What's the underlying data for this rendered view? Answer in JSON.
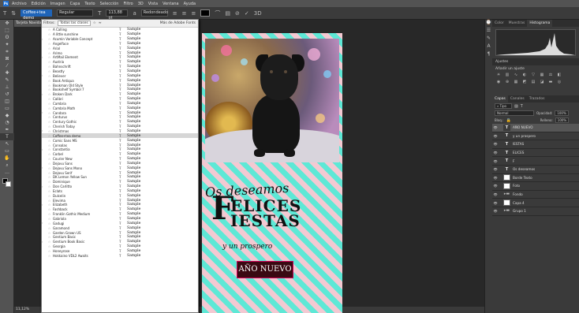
{
  "app": {
    "logo": "Ps"
  },
  "menu": [
    "Archivo",
    "Edición",
    "Imagen",
    "Capa",
    "Texto",
    "Selección",
    "Filtro",
    "3D",
    "Vista",
    "Ventana",
    "Ayuda"
  ],
  "options": {
    "font_family": "Coffee+tea demo",
    "font_style": "Regular",
    "font_size": "113,88 pt",
    "antialias": "Redondeado",
    "text_color": "#000000"
  },
  "document": {
    "tab_title": "Tarjeta Navidad.psd",
    "zoom": "11,12%"
  },
  "font_panel": {
    "filter_label": "Filtros:",
    "filter_value": "Todas las clases",
    "adobe_fonts": "Más de Adobe Fonts",
    "sample": "Sample",
    "fonts": [
      "A Calling",
      "A little sunshine",
      "Acumin Variable Concept",
      "Angelface",
      "Arial",
      "Arimo",
      "ArtMail Element",
      "Austria",
      "Bahnschrift",
      "Beastly",
      "Believer",
      "Book Antiqua",
      "Bookman Old Style",
      "Bookshelf Symbol 7",
      "Broken Dark",
      "Calibri",
      "Cambria",
      "Cambria Math",
      "Candara",
      "Centurus",
      "Century Gothic",
      "Cherish Today",
      "Christmas",
      "Coffee+tea demo",
      "Comic Sans MS",
      "Consolas",
      "Constantia",
      "Corbel",
      "Courier New",
      "Dejavu Sans",
      "Dejavu Sans Mono",
      "Dejavu Serif",
      "DK Lemon Yellow Sun",
      "Dominique",
      "Don Carlitto",
      "Eclats",
      "Dulcelin",
      "Elevima",
      "Elizabeth",
      "Fashback",
      "Franklin Gothic Medium",
      "Gabriola",
      "Gadugi",
      "Garamond",
      "Garden Grown US",
      "Gentium Basic",
      "Gentium Book Basic",
      "Georgia",
      "Honeyrose",
      "Hokkaino VDL2 Awaits"
    ],
    "highlighted_index": 23
  },
  "canvas": {
    "line1": "Os deseamos",
    "big_letter": "F",
    "line2": "ELICES",
    "line3": "IESTAS",
    "line4": "y un prospero",
    "line5": "AÑO NUEVO"
  },
  "right_panel": {
    "top_tabs": [
      "Color",
      "Muestras",
      "Histograma"
    ],
    "active_top_tab": "Histograma",
    "adjustments_title": "Ajustes",
    "adjustments_hint": "Añadir un ajuste",
    "layer_tabs": [
      "Capas",
      "Canales",
      "Trazados"
    ],
    "blend_mode": "Normal",
    "opacity_label": "Opacidad:",
    "opacity_value": "100%",
    "lock_label": "Bloq.:",
    "fill_label": "Relleno:",
    "fill_value": "100%",
    "layers": [
      {
        "name": "AÑO NUEVO",
        "kind": "text",
        "selected": true
      },
      {
        "name": "y un prospero",
        "kind": "text"
      },
      {
        "name": "IESTAS",
        "kind": "text"
      },
      {
        "name": "ELICES",
        "kind": "text"
      },
      {
        "name": "F",
        "kind": "text"
      },
      {
        "name": "Os deseamos",
        "kind": "text"
      },
      {
        "name": "Borde Texto",
        "kind": "pixel"
      },
      {
        "name": "Foto",
        "kind": "pixel"
      },
      {
        "name": "Fondo",
        "kind": "folder"
      },
      {
        "name": "Capa 4",
        "kind": "pixel"
      },
      {
        "name": "Grupo 1",
        "kind": "folder"
      }
    ]
  }
}
